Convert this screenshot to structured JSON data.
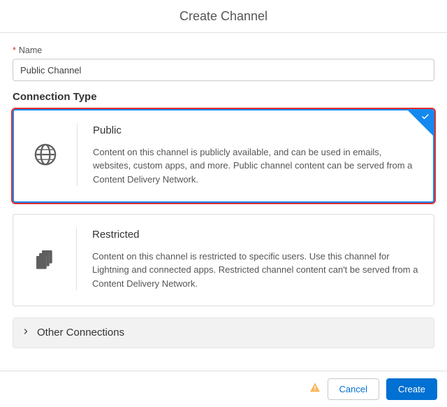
{
  "header": {
    "title": "Create Channel"
  },
  "name_field": {
    "required_mark": "*",
    "label": "Name",
    "value": "Public Channel"
  },
  "connection_type": {
    "label": "Connection Type",
    "options": [
      {
        "title": "Public",
        "description": "Content on this channel is publicly available, and can be used in emails, websites, custom apps, and more. Public channel content can be served from a Content Delivery Network.",
        "icon": "globe-icon",
        "selected": true
      },
      {
        "title": "Restricted",
        "description": "Content on this channel is restricted to specific users. Use this channel for Lightning and connected apps. Restricted channel content can't be served from a Content Delivery Network.",
        "icon": "copy-icon",
        "selected": false
      }
    ]
  },
  "other_section": {
    "label": "Other Connections"
  },
  "footer": {
    "cancel": "Cancel",
    "create": "Create"
  },
  "colors": {
    "brand": "#0070d2",
    "highlight_border": "#e12b2b"
  }
}
